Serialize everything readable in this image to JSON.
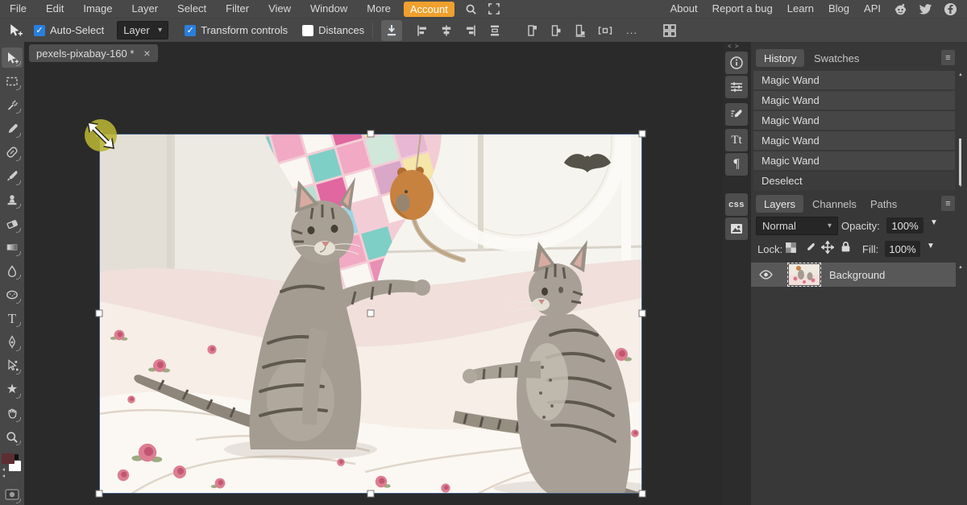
{
  "menubar": {
    "items": [
      "File",
      "Edit",
      "Image",
      "Layer",
      "Select",
      "Filter",
      "View",
      "Window",
      "More"
    ],
    "account": "Account",
    "right_items": [
      "About",
      "Report a bug",
      "Learn",
      "Blog",
      "API"
    ],
    "icons": [
      "search-icon",
      "fullscreen-icon",
      "reddit-icon",
      "twitter-icon",
      "facebook-icon"
    ]
  },
  "options_bar": {
    "auto_select_label": "Auto-Select",
    "auto_select_checked": true,
    "target_value": "Layer",
    "transform_controls_label": "Transform controls",
    "transform_controls_checked": true,
    "distances_label": "Distances",
    "distances_checked": false,
    "icons": [
      "move-tool-icon",
      "export-icon",
      "align-left-icon",
      "align-center-h-icon",
      "align-right-icon",
      "distribute-v-icon",
      "align-top-icon",
      "align-middle-icon",
      "align-bottom-icon",
      "distribute-h-icon",
      "more-options",
      "grid-view-icon"
    ]
  },
  "document_tab": {
    "title": "pexels-pixabay-160 *"
  },
  "left_toolbar": {
    "selected_tool": "move",
    "tools": [
      "move",
      "rectangle-select",
      "magic-wand",
      "eyedropper",
      "spot-heal",
      "brush",
      "clone-stamp",
      "eraser",
      "gradient",
      "blur",
      "dodge-burn",
      "type",
      "pen",
      "path-select",
      "shape-star",
      "hand",
      "zoom"
    ]
  },
  "color_swatches": {
    "foreground": "#5c2e33",
    "background": "#ffffff"
  },
  "side_strip": {
    "character_glyph": "Tt",
    "paragraph_glyph": "¶",
    "css_glyph": "css",
    "icons": [
      "info-icon",
      "adjustments-icon",
      "brush-settings-icon",
      "character-panel-icon",
      "paragraph-panel-icon",
      "css-panel-icon",
      "image-panel-icon"
    ]
  },
  "panel_collapse": {
    "left": "< >",
    "right": "> <"
  },
  "history_panel": {
    "tabs": [
      "History",
      "Swatches"
    ],
    "active_tab": "History",
    "items": [
      "Magic Wand",
      "Magic Wand",
      "Magic Wand",
      "Magic Wand",
      "Magic Wand",
      "Deselect"
    ]
  },
  "layers_panel": {
    "tabs": [
      "Layers",
      "Channels",
      "Paths"
    ],
    "active_tab": "Layers",
    "blend_mode": "Normal",
    "opacity_label": "Opacity:",
    "opacity_value": "100%",
    "lock_label": "Lock:",
    "fill_label": "Fill:",
    "fill_value": "100%",
    "layers": [
      {
        "name": "Background",
        "visible": true,
        "selected": true
      }
    ]
  },
  "glyphs": {
    "check": "✓",
    "dropdown_chevron": "▾",
    "value_arrow": "▼",
    "hamburger": "≡",
    "close": "×",
    "ellipsis": "...",
    "scroll_up": "▲",
    "scroll_down": "▼",
    "type_tool": "T",
    "star_tool": "★"
  },
  "colors": {
    "accent_orange": "#efa02e",
    "checkbox_blue": "#2a7fdc",
    "selection_border": "#3f5b80",
    "foreground_swatch": "#5c2e33",
    "cursor_highlight": "#b7b433"
  }
}
